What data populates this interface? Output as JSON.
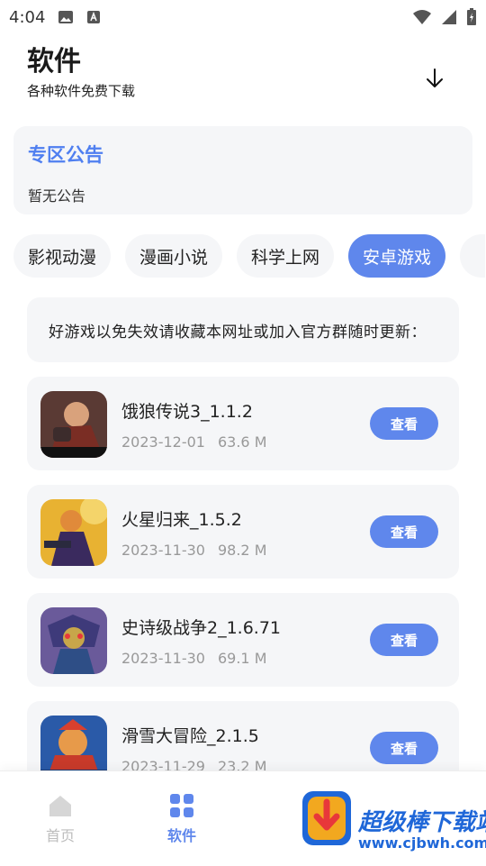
{
  "status_bar": {
    "time": "4:04",
    "left_icons": [
      "image-icon",
      "a-letter-icon"
    ],
    "right_icons": [
      "wifi-icon",
      "signal-icon",
      "battery-icon"
    ]
  },
  "header": {
    "title": "软件",
    "subtitle": "各种软件免费下载",
    "action_icon": "download-arrow-icon"
  },
  "notice": {
    "title": "专区公告",
    "body": "暂无公告"
  },
  "tabs": [
    {
      "label": "影视动漫",
      "active": false
    },
    {
      "label": "漫画小说",
      "active": false
    },
    {
      "label": "科学上网",
      "active": false
    },
    {
      "label": "安卓游戏",
      "active": true
    }
  ],
  "marquee": {
    "text": "好游戏以免失效请收藏本网址或加入官方群随时更新："
  },
  "apps": [
    {
      "name": "饿狼传说3_1.1.2",
      "date": "2023-12-01",
      "size": "63.6 M",
      "button": "查看"
    },
    {
      "name": "火星归来_1.5.2",
      "date": "2023-11-30",
      "size": "98.2 M",
      "button": "查看"
    },
    {
      "name": "史诗级战争2_1.6.71",
      "date": "2023-11-30",
      "size": "69.1 M",
      "button": "查看"
    },
    {
      "name": "滑雪大冒险_2.1.5",
      "date": "2023-11-29",
      "size": "23.2 M",
      "button": "查看"
    }
  ],
  "bottom_nav": [
    {
      "label": "首页",
      "icon": "home-icon",
      "active": false
    },
    {
      "label": "软件",
      "icon": "grid-icon",
      "active": true
    }
  ],
  "watermark": {
    "text": "超级棒下载站",
    "url": "www.cjbwh.com"
  },
  "colors": {
    "accent": "#5f87ec",
    "notice_title": "#4f7ff0",
    "card_bg": "#f5f6f8",
    "meta_text": "#999999"
  }
}
